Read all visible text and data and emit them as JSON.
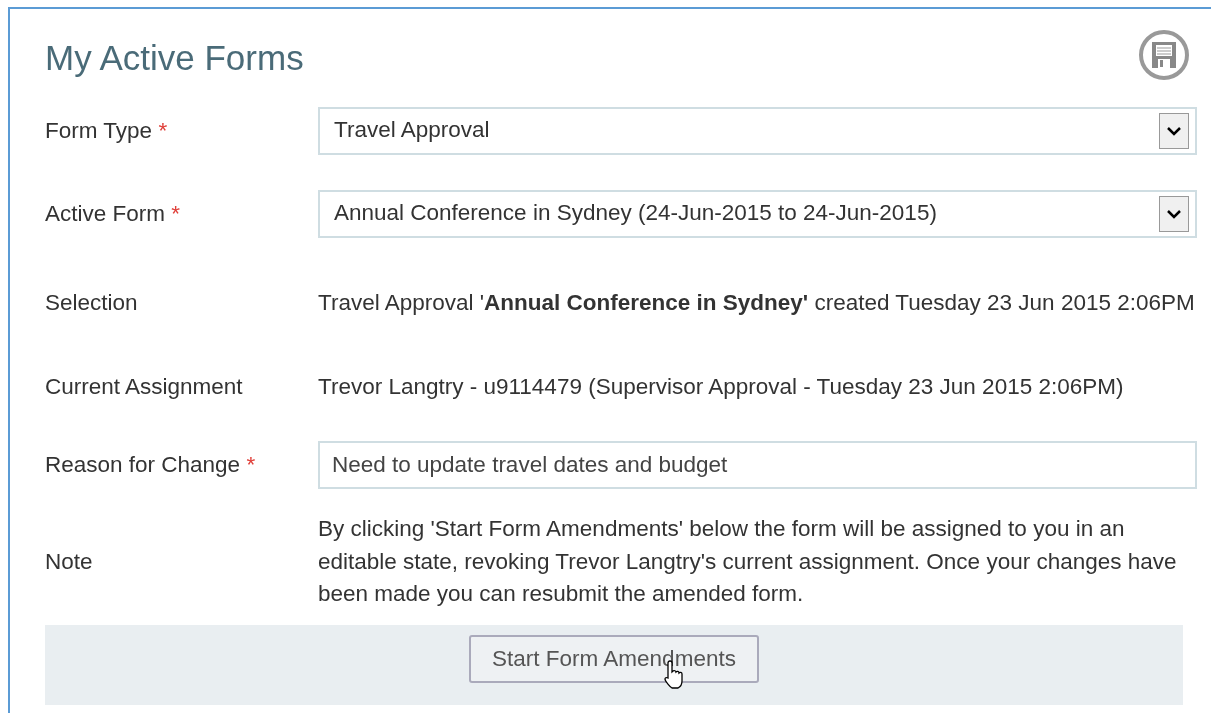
{
  "panel": {
    "title": "My Active Forms"
  },
  "fields": [
    {
      "label": "Form Type",
      "required": true,
      "kind": "select",
      "value": "Travel Approval"
    },
    {
      "label": "Active Form",
      "required": true,
      "kind": "select",
      "value": "Annual Conference in Sydney (24-Jun-2015 to 24-Jun-2015)"
    },
    {
      "label": "Selection",
      "required": false,
      "kind": "text",
      "value": "Travel Approval '**Annual Conference in Sydney'** created Tuesday 23 Jun 2015 2:06PM"
    },
    {
      "label": "Current Assignment",
      "required": false,
      "kind": "text",
      "value": "Trevor Langtry - u9114479 (Supervisor Approval - Tuesday 23 Jun 2015 2:06PM)"
    },
    {
      "label": "Reason for Change",
      "required": true,
      "kind": "input",
      "value": "Need to update travel dates and budget"
    },
    {
      "label": "Note",
      "required": false,
      "kind": "text",
      "value": "By clicking 'Start Form Amendments' below the form will be assigned to you in an editable state, revoking Trevor Langtry's current assignment. Once your changes have been made you can resubmit the amended form."
    }
  ],
  "required_marker": "*",
  "footer": {
    "button": "Start Form Amendments"
  }
}
